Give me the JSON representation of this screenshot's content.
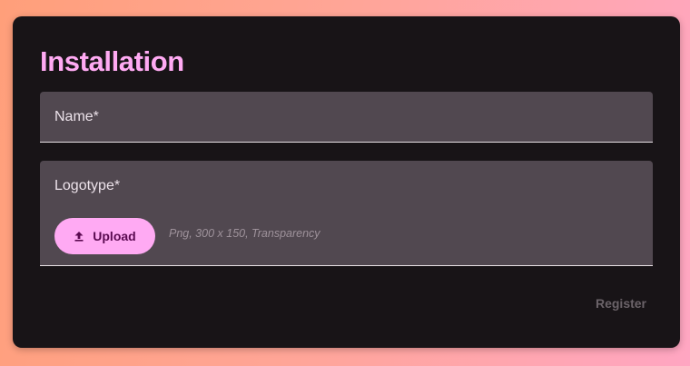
{
  "form": {
    "title": "Installation",
    "name_field": {
      "label": "Name*"
    },
    "logotype_field": {
      "label": "Logotype*",
      "upload_label": "Upload",
      "upload_icon": "upload-icon",
      "hint": "Png, 300 x 150, Transparency"
    },
    "register_label": "Register"
  },
  "colors": {
    "accent": "#ffaaf3",
    "card_background": "#181417",
    "field_background": "#514850",
    "disabled_text": "#6b6369"
  }
}
